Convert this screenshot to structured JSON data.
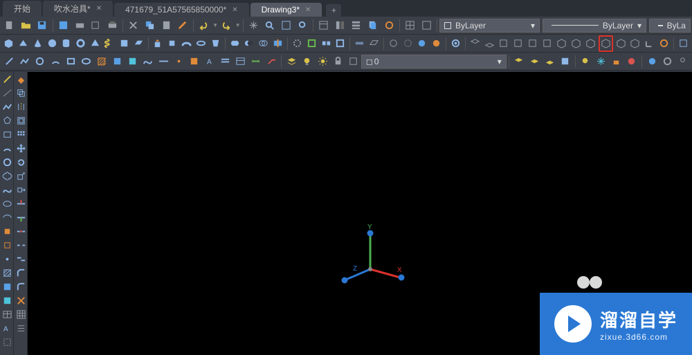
{
  "tabs": [
    {
      "label": "开始",
      "modified": false
    },
    {
      "label": "吹水冶具*",
      "modified": true
    },
    {
      "label": "471679_51A57565850000*",
      "modified": true
    },
    {
      "label": "Drawing3*",
      "modified": true,
      "active": true
    }
  ],
  "tab_add": "+",
  "layer_control": {
    "value": "ByLayer",
    "linetype": "ByLayer",
    "lineweight": "ByLa"
  },
  "layer_state": {
    "current": "0"
  },
  "watermark": {
    "title": "溜溜自学",
    "url": "zixue.3d66.com"
  },
  "toolbar1": [
    "new-icon",
    "open-icon",
    "save-icon",
    "save-as-icon",
    "plot-icon",
    "plot-preview-icon",
    "publish-icon",
    "sep",
    "cut-icon",
    "copy-icon",
    "paste-icon",
    "match-prop-icon",
    "sep",
    "undo-icon",
    "dd",
    "redo-icon",
    "dd",
    "sep",
    "pan-icon",
    "zoom-extents-icon",
    "zoom-window-icon",
    "zoom-icon",
    "sep",
    "properties-icon",
    "design-center-icon",
    "tool-palettes-icon",
    "sheet-set-icon",
    "markup-icon",
    "sep",
    "table-icon",
    "layout-icon",
    "sep",
    "layer-dd",
    "linetype-dd",
    "lineweight-dd"
  ],
  "toolbar2": [
    "box-icon",
    "wedge-icon",
    "cone-icon",
    "sphere-icon",
    "cylinder-icon",
    "torus-icon",
    "pyramid-icon",
    "helix-icon",
    "polysolid-icon",
    "planar-icon",
    "sep",
    "extrude-icon",
    "presspull-icon",
    "sweep-icon",
    "revolve-icon",
    "loft-icon",
    "sep",
    "union-icon",
    "subtract-icon",
    "intersect-icon",
    "sep",
    "slice-icon",
    "thicken-icon",
    "imprint-icon",
    "separate-icon",
    "shell-icon",
    "sep",
    "fillet-edge-icon",
    "chamfer-edge-icon",
    "sep",
    "section-icon",
    "section-plane-icon",
    "live-section-icon",
    "flatten-icon",
    "sep",
    "hide-icon",
    "visual-style-2d-icon",
    "visual-style-hidden-icon",
    "visual-style-realistic-icon",
    "visual-style-conceptual-icon",
    "sep",
    "orbit-icon",
    "free-orbit-icon",
    "continuous-orbit-icon",
    "sep",
    "view-top-icon",
    "view-bottom-icon",
    "view-left-icon",
    "view-right-icon",
    "view-front-icon",
    "view-back-icon",
    "view-sw-icon",
    "view-se-icon",
    "view-ne-icon",
    "view-nw-icon",
    "sep",
    "ucs-icon",
    "ucs-world-icon",
    "ucs-prev-icon",
    "ucs-face-icon",
    "sep",
    "3d-align-icon",
    "3d-move-icon",
    "3d-rotate-icon"
  ],
  "toolbar3": [
    "line-icon",
    "polyline-icon",
    "circle-icon",
    "arc-icon",
    "rectangle-icon",
    "ellipse-icon",
    "hatch-icon",
    "gradient-icon",
    "region-icon",
    "revision-icon",
    "spline-icon",
    "xline-icon",
    "ray-icon",
    "point-icon",
    "donut-icon",
    "text-icon",
    "mtext-icon",
    "table2-icon",
    "sep",
    "layer-props-icon",
    "sun-icon",
    "light-icon",
    "freeze-icon",
    "lock-icon",
    "color-icon",
    "layer-state-dd",
    "sep",
    "layer-list-icon",
    "layer-iso-icon",
    "layer-freeze-icon",
    "layer-off-icon",
    "layer-on-icon",
    "sep",
    "bulb-icon",
    "freeze2-icon",
    "lock2-icon",
    "color2-icon",
    "sep",
    "render-icon",
    "materials-icon",
    "lights-icon"
  ],
  "sidetools_left": [
    "line-icon",
    "xline-icon",
    "pline-icon",
    "polygon-icon",
    "rectangle-icon",
    "arc-icon",
    "circle-icon",
    "revision-cloud-icon",
    "spline-icon",
    "ellipse-icon",
    "ellipse-arc-icon",
    "block-icon",
    "point-icon",
    "hatch-icon",
    "gradient-icon",
    "region-icon",
    "table-icon",
    "mtext-icon",
    "addsel-icon",
    "wipeout-icon"
  ],
  "sidetools_right": [
    "erase-icon",
    "copy-icon",
    "mirror-icon",
    "offset-icon",
    "array-icon",
    "move-icon",
    "rotate-icon",
    "scale-icon",
    "stretch-icon",
    "trim-icon",
    "extend-icon",
    "break-icon",
    "break-at-icon",
    "join-icon",
    "chamfer-icon",
    "fillet-icon",
    "explode-icon",
    "align-icon",
    "lengthen-icon",
    "edit-pline-icon"
  ]
}
